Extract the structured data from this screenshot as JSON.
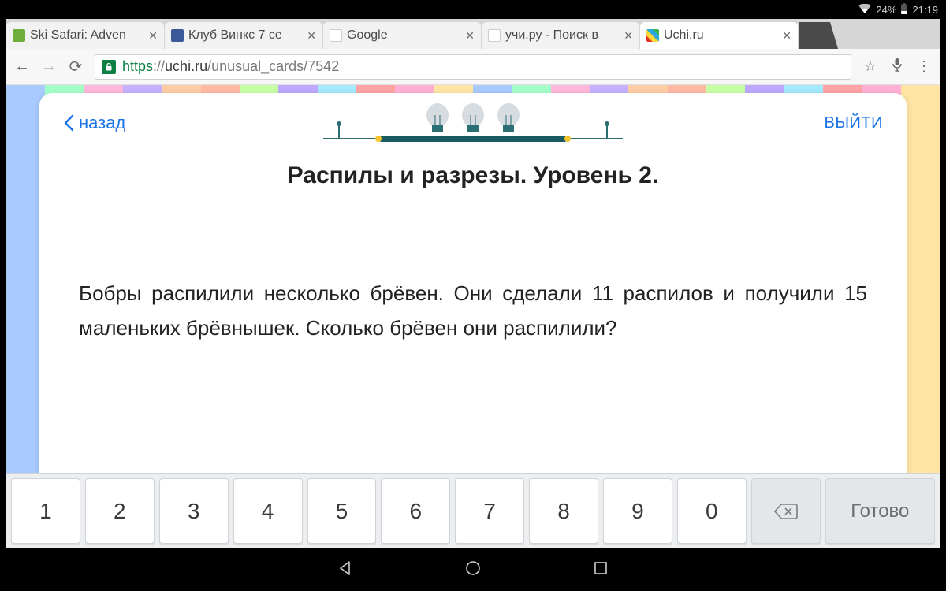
{
  "status_bar": {
    "battery": "24%",
    "time": "21:19"
  },
  "tabs": [
    {
      "title": "Ski Safari: Adven",
      "favicon": "fav-green"
    },
    {
      "title": "Клуб Винкс 7 се",
      "favicon": "fav-blue"
    },
    {
      "title": "Google",
      "favicon": "fav-white"
    },
    {
      "title": "учи.ру - Поиск в",
      "favicon": "fav-white"
    },
    {
      "title": "Uchi.ru",
      "favicon": "fav-multi",
      "active": true
    }
  ],
  "omnibox": {
    "scheme": "https",
    "host_prefix": "://",
    "host": "uchi.ru",
    "path": "/unusual_cards/7542"
  },
  "card": {
    "back_label": "назад",
    "exit_label": "ВЫЙТИ",
    "title": "Распилы и разрезы. Уровень 2.",
    "problem": "Бобры распилили несколько брёвен. Они сделали 11 распилов и получили 15 маленьких брёвнышек. Сколько брёвен они распилили?"
  },
  "keyboard": {
    "keys": [
      "1",
      "2",
      "3",
      "4",
      "5",
      "6",
      "7",
      "8",
      "9",
      "0"
    ],
    "done_label": "Готово"
  },
  "bg_colors": [
    "#a0c4ff",
    "#b8a0ff",
    "#ffb0d9",
    "#ff9a9a",
    "#ffc89a",
    "#ffe29a",
    "#c1ff9a",
    "#9affc3",
    "#9ae8ff",
    "#c0a8ff",
    "#ffa8d0",
    "#ffb29a"
  ]
}
